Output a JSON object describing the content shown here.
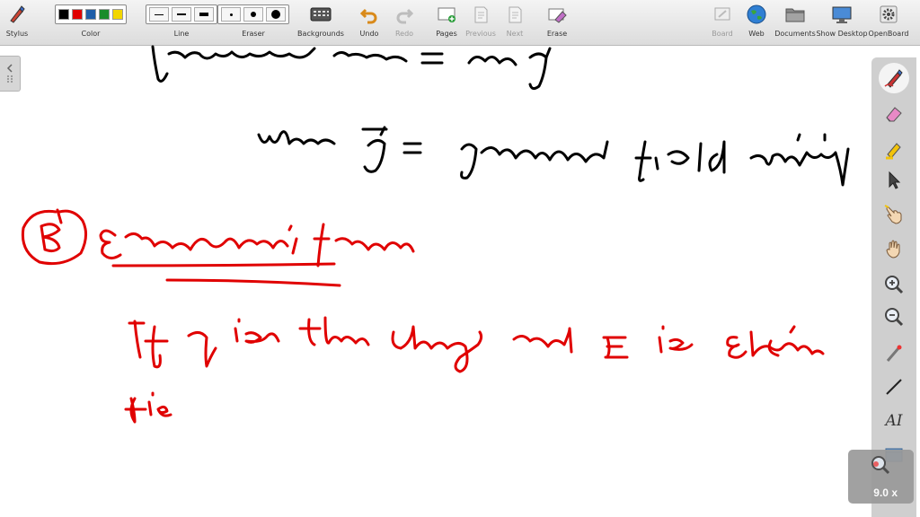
{
  "toolbar": {
    "stylus": "Stylus",
    "color": "Color",
    "line": "Line",
    "eraser": "Eraser",
    "backgrounds": "Backgrounds",
    "undo": "Undo",
    "redo": "Redo",
    "pages": "Pages",
    "previous": "Previous",
    "next": "Next",
    "erase": "Erase",
    "board": "Board",
    "web": "Web",
    "documents": "Documents",
    "show_desktop": "Show Desktop",
    "openboard": "OpenBoard",
    "colors": [
      "#000000",
      "#e00000",
      "#1f5ea8",
      "#1a8c2a",
      "#f2d600"
    ]
  },
  "board": {
    "line1": "gravitional force = m g",
    "line2": "where g = gravitional field entesity",
    "heading_marker": "B",
    "heading": "Electrostatic force",
    "line3": "If q is the charge and E is Electric",
    "line4": "fie",
    "ink_black": "#000000",
    "ink_red": "#e00000"
  },
  "palette": {
    "text_tool": "AI",
    "zoom": "9.0 x"
  }
}
